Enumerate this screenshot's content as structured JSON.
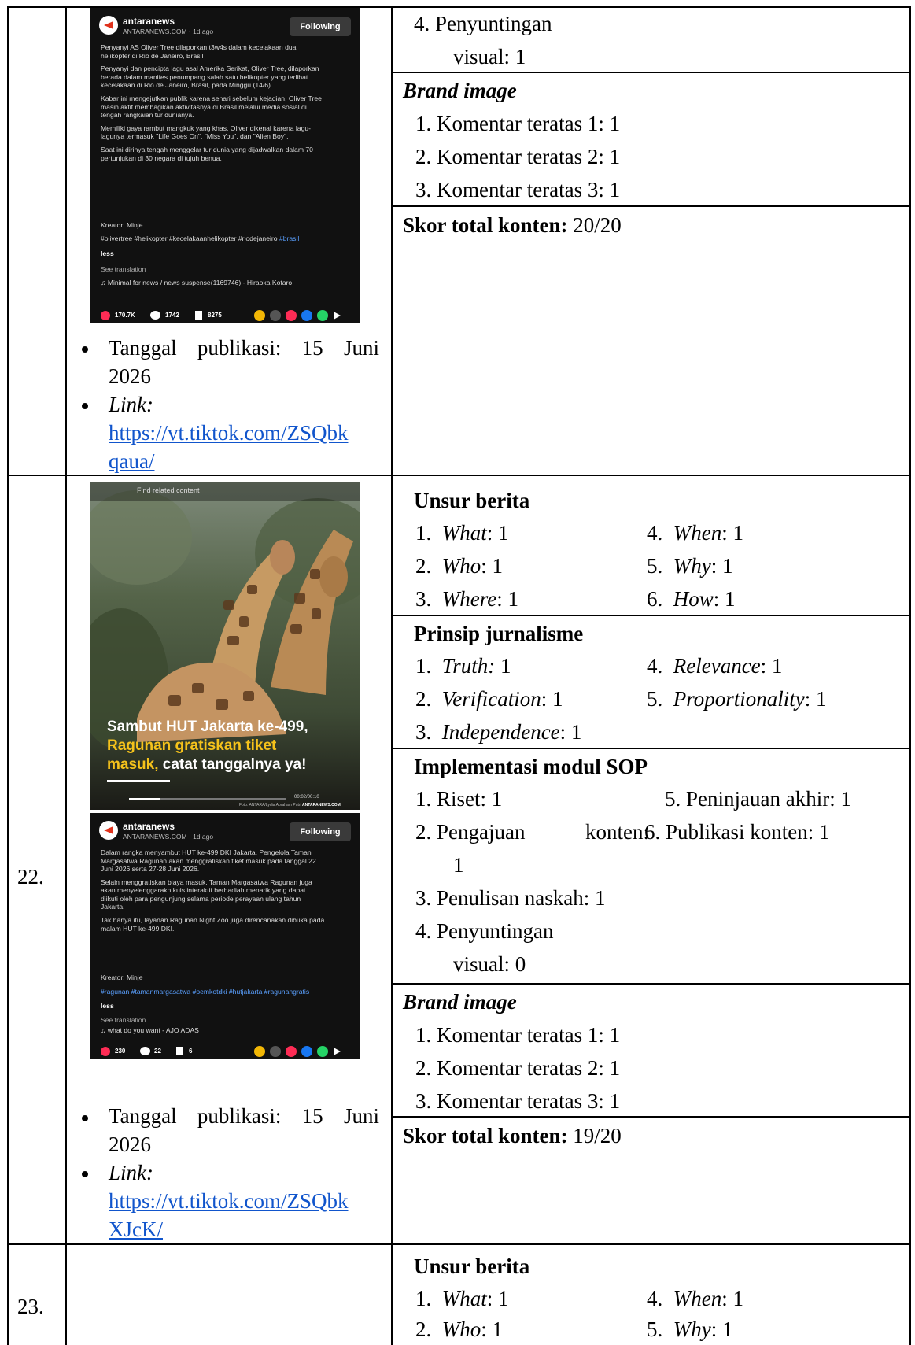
{
  "row21": {
    "post": {
      "account": "antaranews",
      "sub": "ANTARANEWS.COM · 1d ago",
      "follow": "Following",
      "lines": [
        "Penyanyi AS Oliver Tree dilaporkan t3w4s dalam kecelakaan dua",
        "helikopter di Rio de Janeiro, Brasil",
        "",
        "Penyanyi dan pencipta lagu asal Amerika Serikat, Oliver Tree, dilaporkan",
        "berada dalam manifes penumpang salah satu helikopter yang terlibat",
        "kecelakaan di Rio de Janeiro, Brasil, pada Minggu (14/6).",
        "",
        "Kabar ini mengejutkan publik karena sehari sebelum kejadian, Oliver Tree",
        "masih aktif membagikan aktivitasnya di Brasil melalui media sosial di",
        "tengah rangkaian tur dunianya.",
        "",
        "Memiliki gaya rambut mangkuk yang khas, Oliver dikenal karena lagu-",
        "lagunya termasuk \"Life Goes On\", \"Miss You\", dan \"Alien Boy\".",
        "",
        "Saat ini dirinya tengah menggelar tur dunia yang dijadwalkan dalam 70",
        "pertunjukan di 30 negara di tujuh benua."
      ],
      "creator": "Kreator: Minje",
      "hashtags": "#olivertree #helikopter #kecelakaanhelikopter #riodejaneiro",
      "hashtag_blue": "#brasil",
      "less": "less",
      "see_translation": "See translation",
      "music": "♫  Minimal for news / news suspense(1169746) - Hiraoka Kotaro",
      "likes": "170.7K",
      "comments": "1742",
      "saves": "8275"
    },
    "date_label": "Tanggal publikasi: 15 Juni",
    "date_year": "2026",
    "link_label": "Link:",
    "link_line1": "https://vt.tiktok.com/ZSQbk",
    "link_line2": "qaua/",
    "sop_item4_a": "4.  Penyuntingan",
    "sop_item4_b": "visual: 1",
    "brand_title": "Brand image",
    "brand_items": [
      "1.  Komentar teratas 1: 1",
      "2.  Komentar teratas 2: 1",
      "3.  Komentar teratas 3: 1"
    ],
    "score_label": "Skor total konten:",
    "score_value": " 20/20"
  },
  "row22": {
    "number": "22.",
    "video": {
      "search_hint": "Find related content",
      "caption1": "Sambut HUT Jakarta ke-499,",
      "caption2": "Ragunan gratiskan tiket",
      "caption3a": "masuk,",
      "caption3b": " catat tanggalnya ya!",
      "time": "00:02/00:10",
      "credit": "Foto: ANTARA/Lydia Abraham Putri",
      "watermark": "ANTARANEWS.COM"
    },
    "post": {
      "account": "antaranews",
      "sub": "ANTARANEWS.COM · 1d ago",
      "follow": "Following",
      "lines": [
        "Dalam rangka menyambut HUT ke-499 DKI Jakarta, Pengelola Taman",
        "Margasatwa Ragunan akan menggratiskan tiket masuk pada tanggal 22",
        "Juni 2026 serta 27-28 Juni 2026.",
        "",
        "Selain menggratiskan biaya masuk, Taman Margasatwa Ragunan juga",
        "akan menyelenggarakn kuis interaktif berhadiah menarik yang dapat",
        "diikuti oleh para pengunjung selama periode perayaan ulang tahun",
        "Jakarta.",
        "",
        "Tak hanya itu, layanan Ragunan Night Zoo juga direncanakan dibuka pada",
        "malam HUT ke-499 DKI."
      ],
      "creator": "Kreator: Minje",
      "hashtags": "#ragunan #tamanmargasatwa #pemkotdki #hutjakarta #ragunangratis",
      "less": "less",
      "see_translation": "See translation",
      "music": "♫  what do you want - AJO ADAS",
      "likes": "230",
      "comments": "22",
      "saves": "6"
    },
    "date_label": "Tanggal publikasi: 15 Juni",
    "date_year": "2026",
    "link_label": "Link:",
    "link_line1": "https://vt.tiktok.com/ZSQbk",
    "link_line2": "XJcK/",
    "unsur_title": "Unsur berita",
    "unsur": [
      {
        "n": "1.",
        "k": "What",
        "v": ": 1"
      },
      {
        "n": "2.",
        "k": "Who",
        "v": ": 1"
      },
      {
        "n": "3.",
        "k": "Where",
        "v": ": 1"
      },
      {
        "n": "4.",
        "k": "When",
        "v": ": 1"
      },
      {
        "n": "5.",
        "k": "Why",
        "v": ": 1"
      },
      {
        "n": "6.",
        "k": "How",
        "v": ": 1"
      }
    ],
    "prinsip_title": "Prinsip jurnalisme",
    "prinsip": [
      {
        "n": "1.",
        "k": "Truth:",
        "v": " 1"
      },
      {
        "n": "2.",
        "k": "Verification",
        "v": ": 1"
      },
      {
        "n": "3.",
        "k": "Independence",
        "v": ": 1"
      },
      {
        "n": "4.",
        "k": "Relevance",
        "v": ": 1"
      },
      {
        "n": "5.",
        "k": "Proportionality",
        "v": ": 1"
      }
    ],
    "sop_title": "Implementasi modul SOP",
    "sop": {
      "i1": "1.  Riset: 1",
      "i2a": "2.  Pengajuan",
      "i2b": "konten:",
      "i2c": "1",
      "i3": "3.  Penulisan naskah: 1",
      "i4a": "4.  Penyuntingan",
      "i4b": "visual: 0",
      "i5": "5.  Peninjauan akhir: 1",
      "i6": "6.  Publikasi konten: 1"
    },
    "brand_title": "Brand image",
    "brand_items": [
      "1.  Komentar teratas 1: 1",
      "2.  Komentar teratas 2: 1",
      "3.  Komentar teratas 3: 1"
    ],
    "score_label": "Skor total konten:",
    "score_value": " 19/20"
  },
  "row23": {
    "number": "23.",
    "unsur_title": "Unsur berita",
    "unsur": [
      {
        "n": "1.",
        "k": "What",
        "v": ": 1"
      },
      {
        "n": "2.",
        "k": "Who",
        "v": ": 1"
      },
      {
        "n": "4.",
        "k": "When",
        "v": ": 1"
      },
      {
        "n": "5.",
        "k": "Why",
        "v": ": 1"
      }
    ]
  }
}
